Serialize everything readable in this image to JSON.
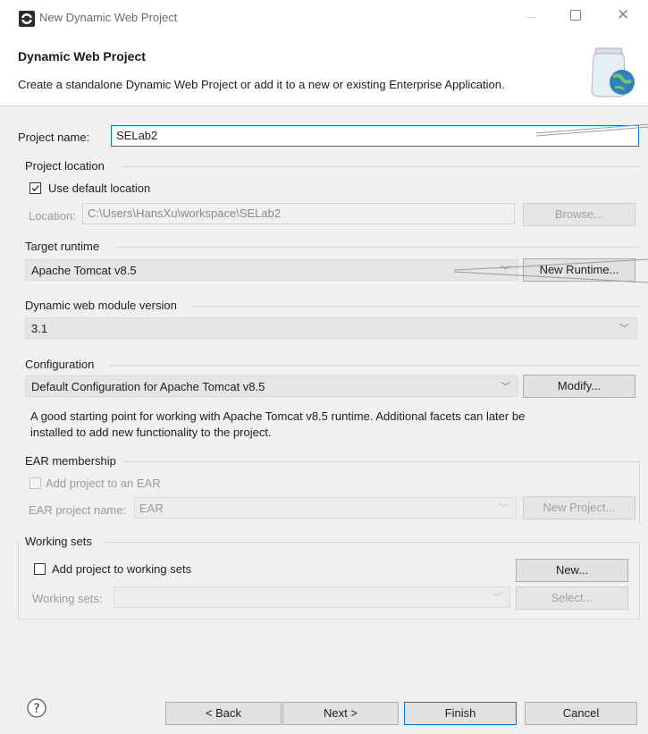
{
  "window": {
    "title": "New Dynamic Web Project"
  },
  "header": {
    "title": "Dynamic Web Project",
    "description": "Create a standalone Dynamic Web Project or add it to a new or existing Enterprise Application."
  },
  "project_name": {
    "label": "Project name:",
    "value": "SELab2"
  },
  "project_location": {
    "group_label": "Project location",
    "use_default_label": "Use default location",
    "use_default_checked": true,
    "location_label": "Location:",
    "location_value": "C:\\Users\\HansXu\\workspace\\SELab2",
    "browse_label": "Browse..."
  },
  "target_runtime": {
    "group_label": "Target runtime",
    "selected": "Apache Tomcat v8.5",
    "new_runtime_label": "New Runtime..."
  },
  "web_module": {
    "group_label": "Dynamic web module version",
    "selected": "3.1"
  },
  "configuration": {
    "group_label": "Configuration",
    "selected": "Default Configuration for Apache Tomcat v8.5",
    "modify_label": "Modify...",
    "description_line1": "A good starting point for working with Apache Tomcat v8.5 runtime. Additional facets can later be",
    "description_line2": "installed to add new functionality to the project."
  },
  "ear": {
    "group_label": "EAR membership",
    "add_label": "Add project to an EAR",
    "add_checked": false,
    "name_label": "EAR project name:",
    "name_value": "EAR",
    "new_project_label": "New Project..."
  },
  "working_sets": {
    "group_label": "Working sets",
    "add_label": "Add project to working sets",
    "add_checked": false,
    "new_label": "New...",
    "sets_label": "Working sets:",
    "select_label": "Select..."
  },
  "footer": {
    "help_icon": "question-circle-icon",
    "back_label": "< Back",
    "next_label": "Next >",
    "finish_label": "Finish",
    "cancel_label": "Cancel"
  },
  "colors": {
    "focus": "#0078d7",
    "background": "#f0f0f0"
  }
}
